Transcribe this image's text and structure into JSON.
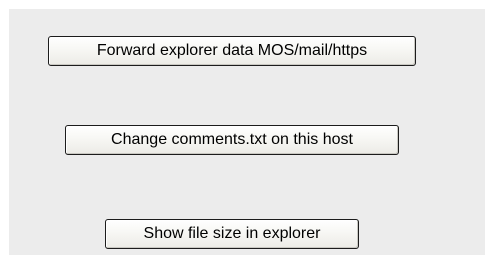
{
  "buttons": {
    "forward_explorer": "Forward explorer data MOS/mail/https",
    "change_comments": "Change comments.txt on this host",
    "show_file_size": "Show file size in explorer"
  }
}
